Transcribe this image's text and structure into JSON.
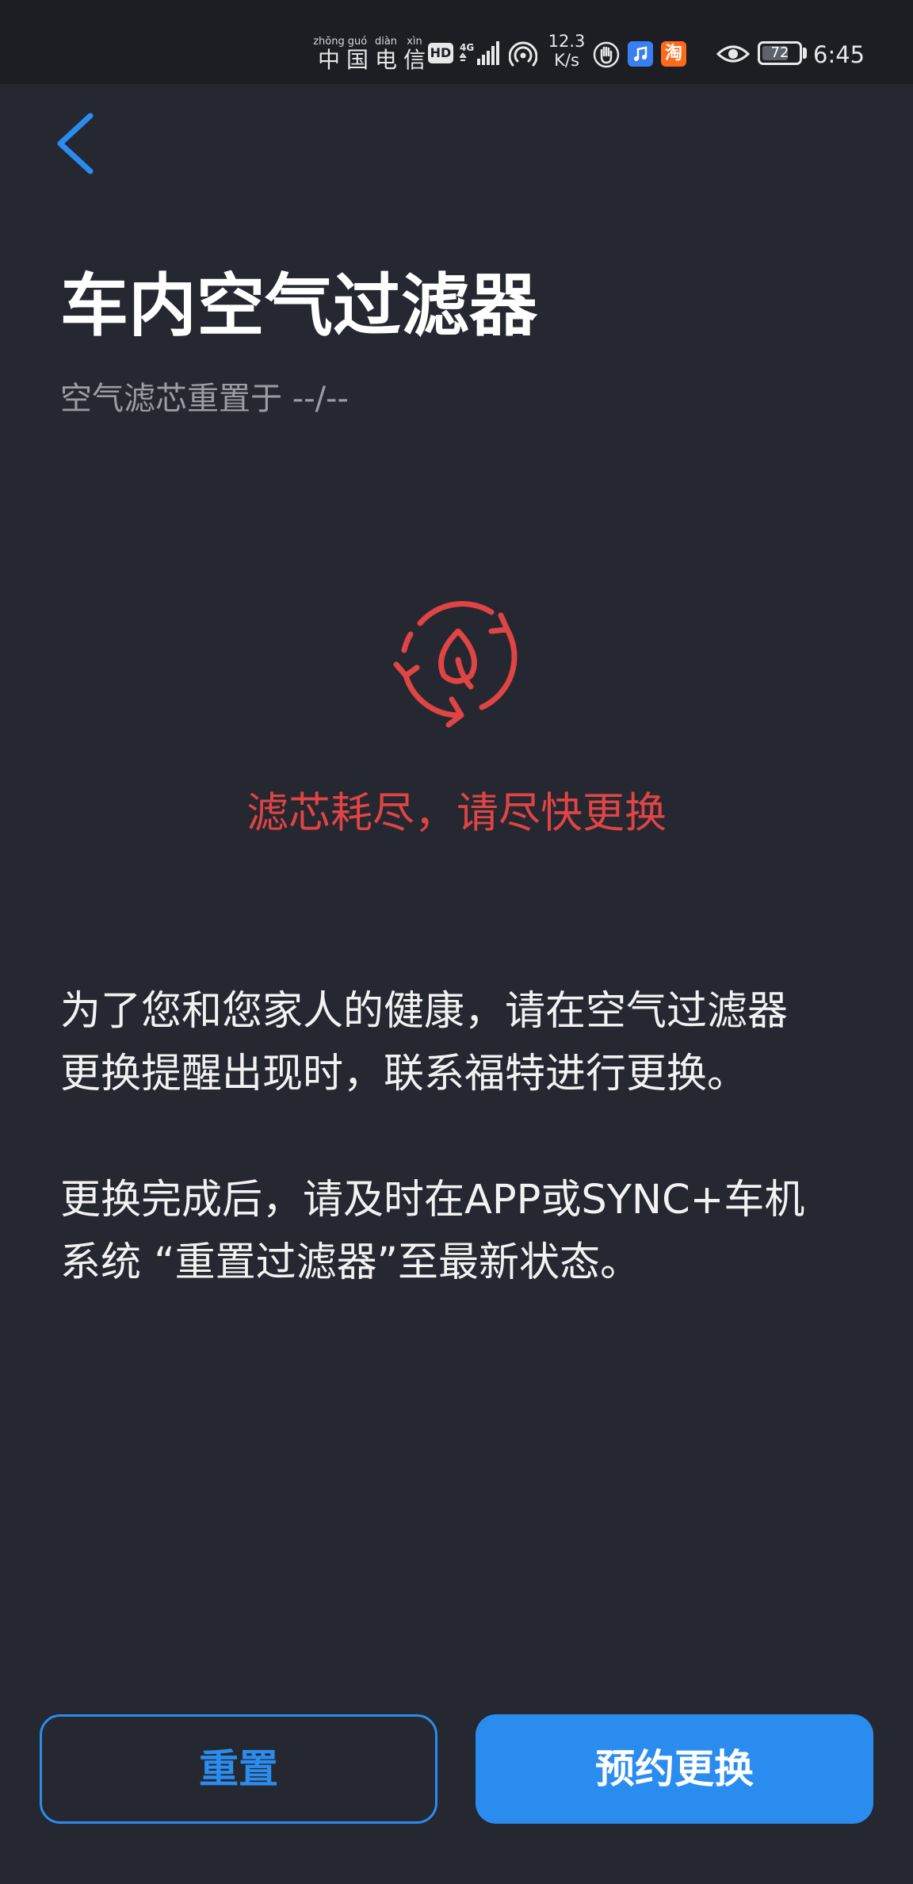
{
  "status_bar": {
    "carrier_chars": [
      {
        "pinyin": "zhōng",
        "hanzi": "中"
      },
      {
        "pinyin": "guó",
        "hanzi": "国"
      },
      {
        "pinyin": "diàn",
        "hanzi": "电"
      },
      {
        "pinyin": "xìn",
        "hanzi": "信"
      }
    ],
    "hd_label": "HD",
    "network_type": "4G",
    "net_speed_value": "12.3",
    "net_speed_unit": "K/s",
    "taobao_label": "淘",
    "battery_level": "72",
    "battery_fraction": 0.72,
    "time": "6:45",
    "icons": [
      "hd-icon",
      "signal-icon",
      "hotspot-icon",
      "hand-icon",
      "music-app-icon",
      "taobao-app-icon",
      "eye-icon",
      "battery-icon"
    ]
  },
  "header": {
    "back_icon": "chevron-left-icon",
    "title": "车内空气过滤器",
    "reset_subtitle": "空气滤芯重置于 --/--"
  },
  "status": {
    "icon": "filter-recycle-leaf-icon",
    "message": "滤芯耗尽，请尽快更换"
  },
  "info": {
    "paragraph_1": {
      "line_1": "为了您和您家人的健康，请在空气过滤器",
      "line_2": "更换提醒出现时，联系福特进行更换。"
    },
    "paragraph_2": {
      "line_1": "更换完成后，请及时在APP或SYNC+车机",
      "line_2": "系统 “重置过滤器”至最新状态。"
    }
  },
  "actions": {
    "reset_label": "重置",
    "schedule_label": "预约更换"
  },
  "colors": {
    "background": "#252830",
    "status_bar_background": "#1c1e24",
    "accent_blue": "#2b8cf0",
    "alert_red": "#e04444",
    "subtitle_gray": "#9a9da4"
  }
}
